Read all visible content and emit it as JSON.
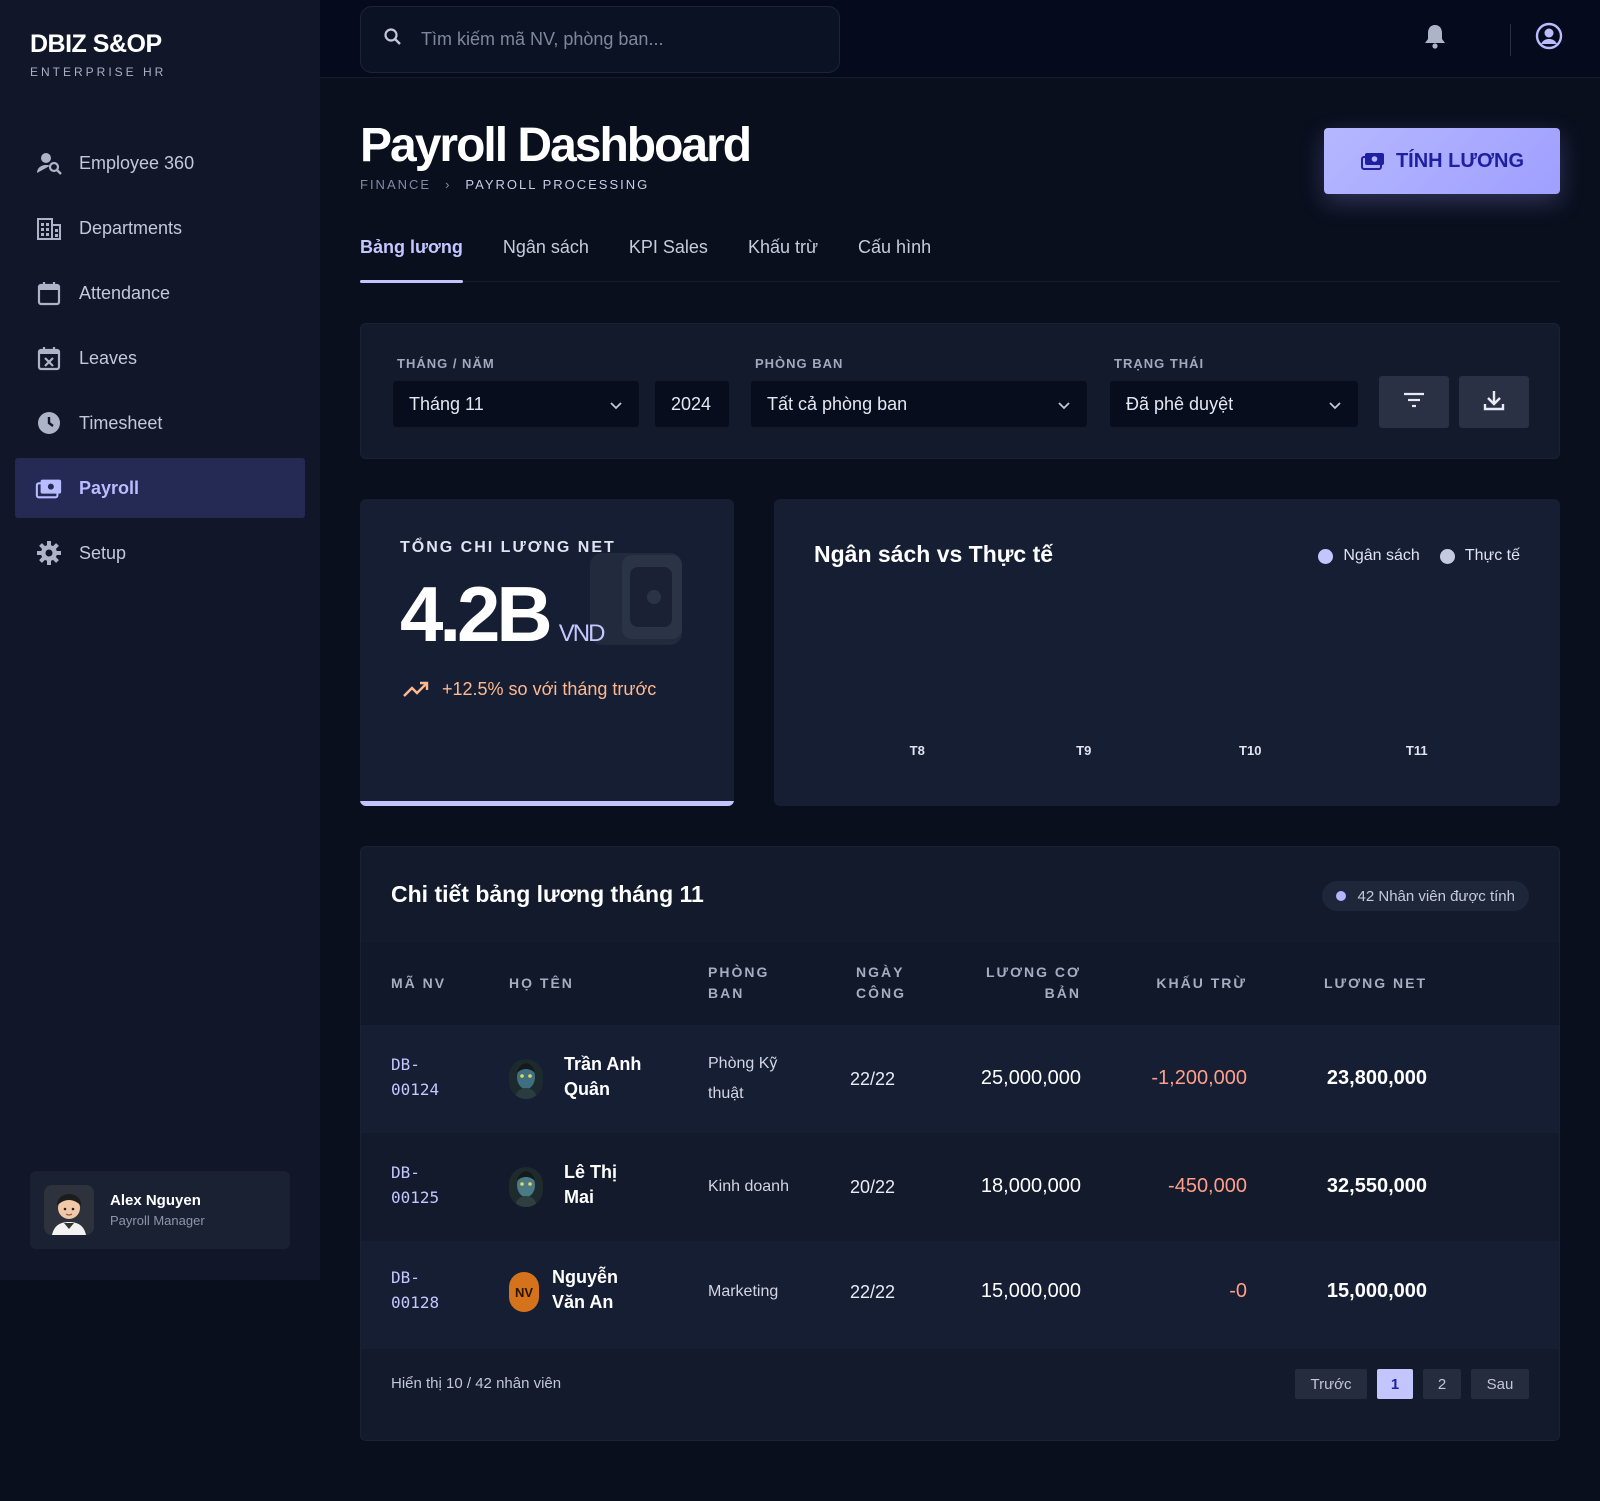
{
  "brand": {
    "title": "DBIZ S&OP",
    "subtitle": "ENTERPRISE HR"
  },
  "sidebar": {
    "items": [
      {
        "label": "Employee 360",
        "icon": "user-search-icon"
      },
      {
        "label": "Departments",
        "icon": "building-icon"
      },
      {
        "label": "Attendance",
        "icon": "calendar-icon"
      },
      {
        "label": "Leaves",
        "icon": "calendar-x-icon"
      },
      {
        "label": "Timesheet",
        "icon": "clock-icon"
      },
      {
        "label": "Payroll",
        "icon": "money-icon",
        "active": true
      },
      {
        "label": "Setup",
        "icon": "gear-icon"
      }
    ]
  },
  "user": {
    "name": "Alex Nguyen",
    "role": "Payroll Manager"
  },
  "search": {
    "placeholder": "Tìm kiếm mã NV, phòng ban..."
  },
  "header": {
    "title": "Payroll Dashboard",
    "breadcrumb": [
      "FINANCE",
      "PAYROLL PROCESSING"
    ],
    "primary_action": "TÍNH LƯƠNG"
  },
  "tabs": [
    {
      "label": "Bảng lương",
      "active": true
    },
    {
      "label": "Ngân sách"
    },
    {
      "label": "KPI Sales"
    },
    {
      "label": "Khấu trừ"
    },
    {
      "label": "Cấu hình"
    }
  ],
  "filters": {
    "month_label": "THÁNG / NĂM",
    "month_value": "Tháng 11",
    "year_value": "2024",
    "dept_label": "PHÒNG BAN",
    "dept_value": "Tất cả phòng ban",
    "status_label": "TRẠNG THÁI",
    "status_value": "Đã phê duyệt"
  },
  "stat": {
    "label": "TỔNG CHI LƯƠNG NET",
    "value": "4.2B",
    "unit": "VND",
    "trend": "+12.5% so với tháng trước"
  },
  "chart_data": {
    "type": "bar",
    "title": "Ngân sách vs Thực tế",
    "categories": [
      "T8",
      "T9",
      "T10",
      "T11"
    ],
    "series": [
      {
        "name": "Ngân sách",
        "color": "#c3c5ff"
      },
      {
        "name": "Thực tế",
        "color": "#c4cadf"
      }
    ],
    "legend": "top-right"
  },
  "table": {
    "title": "Chi tiết bảng lương tháng 11",
    "badge": "42 Nhân viên được tính",
    "headers": {
      "id": "MÃ NV",
      "name": "HỌ TÊN",
      "dept_1": "PHÒNG",
      "dept_2": "BAN",
      "days_1": "NGÀY",
      "days_2": "CÔNG",
      "base_1": "LƯƠNG CƠ",
      "base_2": "BẢN",
      "deduction": "KHẤU TRỪ",
      "net": "LƯƠNG NET"
    },
    "rows": [
      {
        "id_1": "DB-",
        "id_2": "00124",
        "name_1": "Trần Anh",
        "name_2": "Quân",
        "dept_1": "Phòng Kỹ",
        "dept_2": "thuật",
        "days": "22/22",
        "base": "25,000,000",
        "deduction": "-1,200,000",
        "net": "23,800,000"
      },
      {
        "id_1": "DB-",
        "id_2": "00125",
        "name_1": "Lê Thị",
        "name_2": "Mai",
        "dept_1": "Kinh doanh",
        "dept_2": "",
        "days": "20/22",
        "base": "18,000,000",
        "deduction": "-450,000",
        "net": "32,550,000"
      },
      {
        "id_1": "DB-",
        "id_2": "00128",
        "name_1": "Nguyễn",
        "name_2": "Văn An",
        "initials": "NV",
        "dept_1": "Marketing",
        "dept_2": "",
        "days": "22/22",
        "base": "15,000,000",
        "deduction": "-0",
        "net": "15,000,000"
      }
    ],
    "footer": "Hiển thị 10 / 42 nhân viên",
    "pager": {
      "prev": "Trước",
      "pages": [
        "1",
        "2"
      ],
      "current": "1",
      "next": "Sau"
    }
  }
}
